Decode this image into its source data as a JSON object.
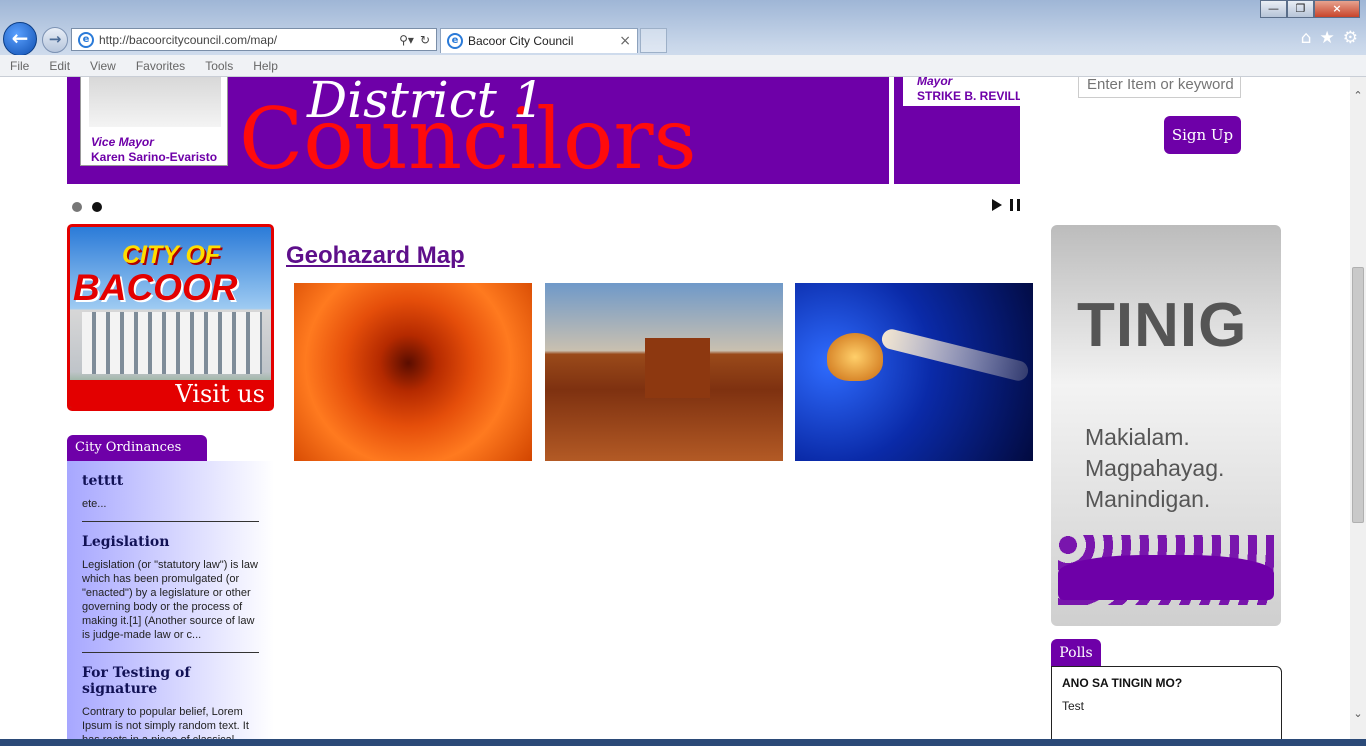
{
  "browser": {
    "url": "http://bacoorcitycouncil.com/map/",
    "tab_title": "Bacoor City Council",
    "menu": [
      "File",
      "Edit",
      "View",
      "Favorites",
      "Tools",
      "Help"
    ]
  },
  "banner": {
    "vice_mayor_role": "Vice Mayor",
    "vice_mayor_name": "Karen Sarino-Evaristo",
    "district_text": "District 1",
    "councilors_text": "Councilors",
    "mayor_role": "Mayor",
    "mayor_name": "STRIKE B. REVILLA"
  },
  "slider": {
    "dots": 2,
    "active_dot": 2
  },
  "search": {
    "placeholder": "Enter Item or keyword"
  },
  "signup": {
    "label": "Sign Up"
  },
  "visit_banner": {
    "line1": "CITY OF",
    "line2": "BACOOR",
    "line3": "Visit us"
  },
  "main": {
    "title": "Geohazard Map",
    "images": [
      "flower-image",
      "desert-image",
      "jellyfish-image"
    ]
  },
  "ordinances": {
    "tab_label": "City Ordinances",
    "items": [
      {
        "title": "tetttt",
        "text": "ete..."
      },
      {
        "title": "Legislation",
        "text": "Legislation (or \"statutory law\") is law which has been promulgated (or \"enacted\") by a legislature or other governing body or the process of making it.[1] (Another source of law is judge-made law or c..."
      },
      {
        "title": "For Testing of signature",
        "text": "Contrary to popular belief, Lorem Ipsum is not simply random text. It has roots in a piece of classical"
      }
    ]
  },
  "tinig": {
    "title": "TINIG",
    "line1": "Makialam.",
    "line2": "Magpahayag.",
    "line3": "Manindigan."
  },
  "polls": {
    "tab_label": "Polls",
    "question": "ANO SA TINGIN MO?",
    "answer": "Test"
  },
  "colors": {
    "brand_purple": "#6e00a8",
    "banner_red": "#ff0b0b"
  }
}
